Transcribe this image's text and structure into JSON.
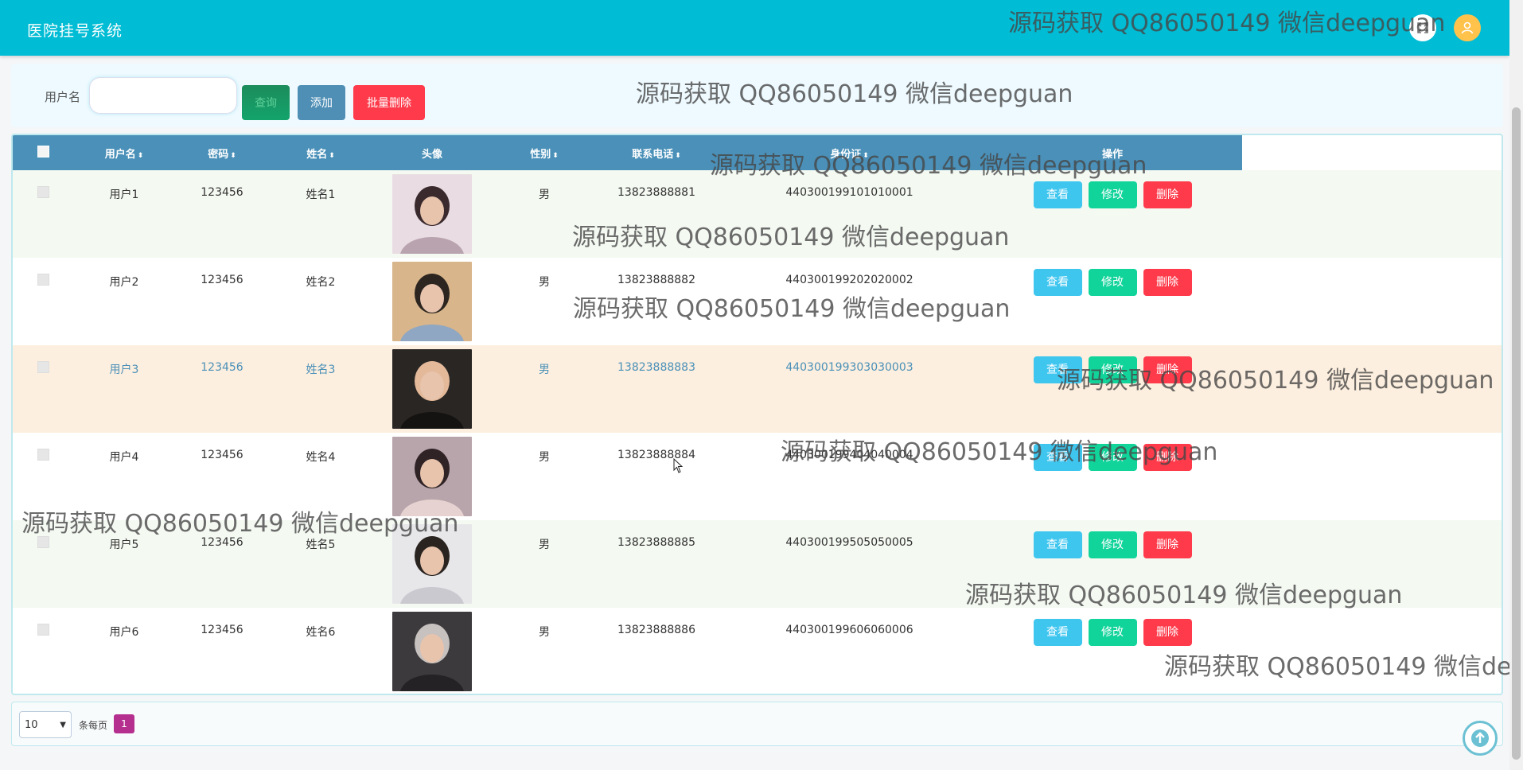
{
  "header": {
    "app_title": "医院挂号系统"
  },
  "search": {
    "label": "用户名",
    "value": "",
    "placeholder": "",
    "search_label": "查询",
    "add_label": "添加",
    "batch_delete_label": "批量删除"
  },
  "table": {
    "columns": [
      "用户名",
      "密码",
      "姓名",
      "头像",
      "性别",
      "联系电话",
      "身份证",
      "操作"
    ],
    "rows": [
      {
        "username": "用户1",
        "password": "123456",
        "name": "姓名1",
        "gender": "男",
        "phone": "13823888881",
        "id_card": "440300199101010001",
        "avatar_icon": "user-photo"
      },
      {
        "username": "用户2",
        "password": "123456",
        "name": "姓名2",
        "gender": "男",
        "phone": "13823888882",
        "id_card": "440300199202020002",
        "avatar_icon": "user-photo"
      },
      {
        "username": "用户3",
        "password": "123456",
        "name": "姓名3",
        "gender": "男",
        "phone": "13823888883",
        "id_card": "440300199303030003",
        "avatar_icon": "user-photo"
      },
      {
        "username": "用户4",
        "password": "123456",
        "name": "姓名4",
        "gender": "男",
        "phone": "13823888884",
        "id_card": "440300199404040004",
        "avatar_icon": "user-photo"
      },
      {
        "username": "用户5",
        "password": "123456",
        "name": "姓名5",
        "gender": "男",
        "phone": "13823888885",
        "id_card": "440300199505050005",
        "avatar_icon": "user-photo"
      },
      {
        "username": "用户6",
        "password": "123456",
        "name": "姓名6",
        "gender": "男",
        "phone": "13823888886",
        "id_card": "440300199606060006",
        "avatar_icon": "user-photo"
      }
    ],
    "actions": {
      "view": "查看",
      "edit": "修改",
      "delete": "删除"
    }
  },
  "pagination": {
    "page_size": "10",
    "per_page_label": "条每页",
    "current_page": "1"
  },
  "watermark": "源码获取 QQ86050149 微信deepguan",
  "colors": {
    "header": "#00bcd4",
    "table_header": "#4a90b8",
    "hover_row": "#fdefdf",
    "view": "#3ec6ef",
    "edit": "#11d49b",
    "delete": "#ff3b4b"
  }
}
